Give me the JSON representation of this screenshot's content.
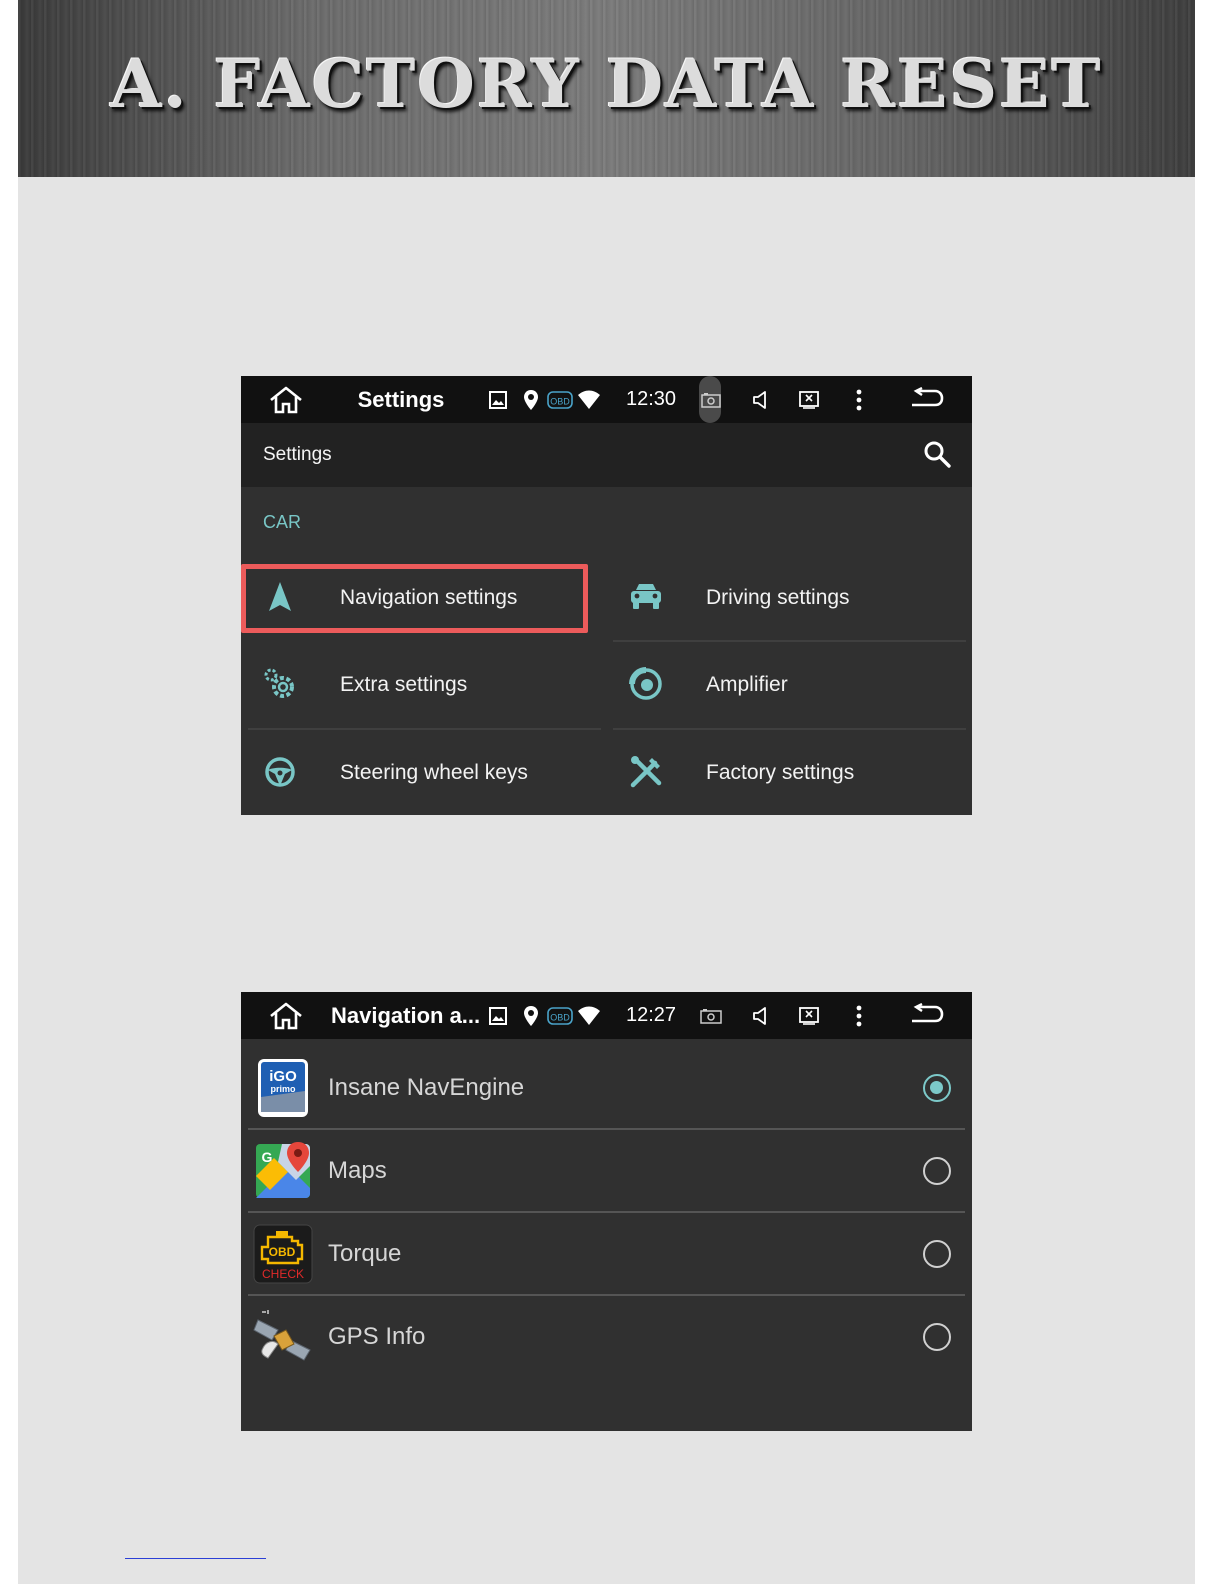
{
  "banner": {
    "title": "A. FACTORY DATA RESET"
  },
  "screen1": {
    "status": {
      "title": "Settings",
      "time": "12:30",
      "obd_badge": "OBD"
    },
    "appbar": {
      "title": "Settings"
    },
    "section": "CAR",
    "items": [
      {
        "label": "Navigation settings",
        "icon": "navigation-arrow-icon",
        "highlighted": true
      },
      {
        "label": "Driving settings",
        "icon": "car-icon"
      },
      {
        "label": "Extra settings",
        "icon": "gears-icon"
      },
      {
        "label": "Amplifier",
        "icon": "speaker-icon"
      },
      {
        "label": "Steering wheel keys",
        "icon": "steering-wheel-icon"
      },
      {
        "label": "Factory settings",
        "icon": "tools-icon"
      }
    ],
    "highlight_color": "#ec5b5b",
    "accent_color": "#79c6c6"
  },
  "screen2": {
    "status": {
      "title": "Navigation a...",
      "time": "12:27",
      "obd_badge": "OBD"
    },
    "apps": [
      {
        "label": "Insane NavEngine",
        "icon": "igo-primo-icon",
        "icon_text_1": "iGO",
        "icon_text_2": "primo",
        "selected": true
      },
      {
        "label": "Maps",
        "icon": "google-maps-icon",
        "icon_text_1": "G",
        "selected": false
      },
      {
        "label": "Torque",
        "icon": "torque-obd-icon",
        "icon_text_1": "OBD",
        "icon_text_2": "CHECK",
        "selected": false
      },
      {
        "label": "GPS Info",
        "icon": "satellite-icon",
        "selected": false
      }
    ]
  }
}
